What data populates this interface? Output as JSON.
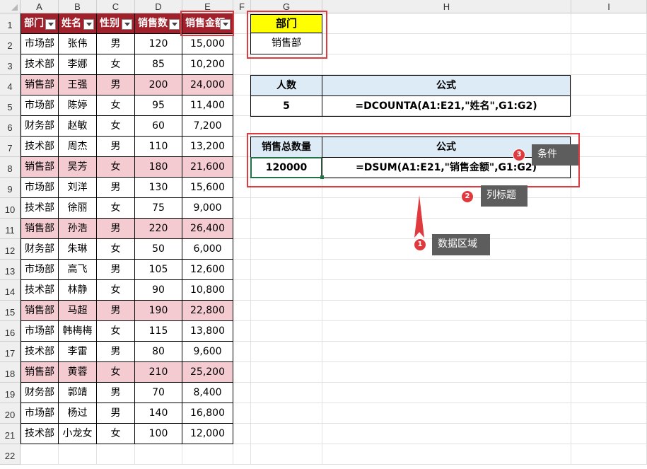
{
  "columns": [
    "A",
    "B",
    "C",
    "D",
    "E",
    "F",
    "G",
    "H",
    "I"
  ],
  "rows": [
    "1",
    "2",
    "3",
    "4",
    "5",
    "6",
    "7",
    "8",
    "9",
    "10",
    "11",
    "12",
    "13",
    "14",
    "15",
    "16",
    "17",
    "18",
    "19",
    "20",
    "21",
    "22"
  ],
  "headers": [
    "部门",
    "姓名",
    "性别",
    "销售数",
    "销售金额"
  ],
  "data": [
    [
      "市场部",
      "张伟",
      "男",
      "120",
      "15,000"
    ],
    [
      "技术部",
      "李娜",
      "女",
      "85",
      "10,200"
    ],
    [
      "销售部",
      "王强",
      "男",
      "200",
      "24,000"
    ],
    [
      "市场部",
      "陈婷",
      "女",
      "95",
      "11,400"
    ],
    [
      "财务部",
      "赵敏",
      "女",
      "60",
      "7,200"
    ],
    [
      "技术部",
      "周杰",
      "男",
      "110",
      "13,200"
    ],
    [
      "销售部",
      "吴芳",
      "女",
      "180",
      "21,600"
    ],
    [
      "市场部",
      "刘洋",
      "男",
      "130",
      "15,600"
    ],
    [
      "技术部",
      "徐丽",
      "女",
      "75",
      "9,000"
    ],
    [
      "销售部",
      "孙浩",
      "男",
      "220",
      "26,400"
    ],
    [
      "财务部",
      "朱琳",
      "女",
      "50",
      "6,000"
    ],
    [
      "市场部",
      "高飞",
      "男",
      "105",
      "12,600"
    ],
    [
      "技术部",
      "林静",
      "女",
      "90",
      "10,800"
    ],
    [
      "销售部",
      "马超",
      "男",
      "190",
      "22,800"
    ],
    [
      "市场部",
      "韩梅梅",
      "女",
      "115",
      "13,800"
    ],
    [
      "技术部",
      "李雷",
      "男",
      "80",
      "9,600"
    ],
    [
      "销售部",
      "黄蓉",
      "女",
      "210",
      "25,200"
    ],
    [
      "财务部",
      "郭靖",
      "男",
      "70",
      "8,400"
    ],
    [
      "市场部",
      "杨过",
      "男",
      "140",
      "16,800"
    ],
    [
      "技术部",
      "小龙女",
      "女",
      "100",
      "12,000"
    ]
  ],
  "criteria": {
    "header": "部门",
    "value": "销售部"
  },
  "table1": {
    "h1": "人数",
    "h2": "公式",
    "v1": "5",
    "v2": "=DCOUNTA(A1:E21,\"姓名\",G1:G2)"
  },
  "table2": {
    "h1": "销售总数量",
    "h2": "公式",
    "v1": "120000",
    "v2": "=DSUM(A1:E21,\"销售金额\",G1:G2)"
  },
  "callouts": [
    {
      "num": "1",
      "label": "数据区域"
    },
    {
      "num": "2",
      "label": "列标题"
    },
    {
      "num": "3",
      "label": "条件"
    }
  ],
  "colors": {
    "header_red": "#a0212b",
    "highlight_pink": "#f4cbd1",
    "criteria_yellow": "#ffff00",
    "table_blue": "#ddebf7",
    "frame_red": "#e03a3e"
  }
}
